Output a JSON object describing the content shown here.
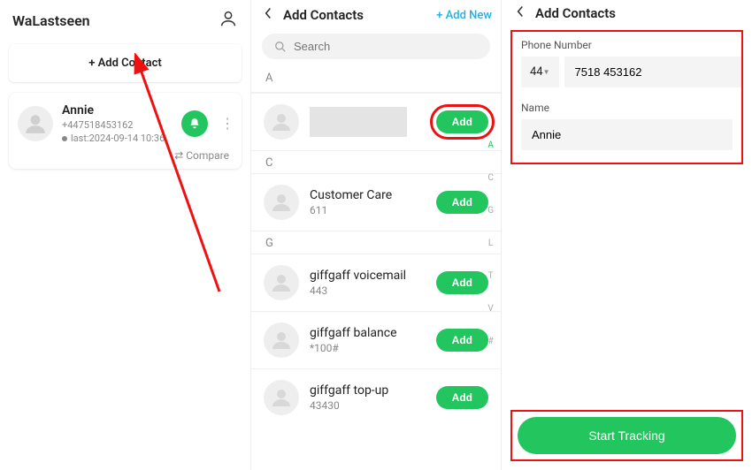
{
  "app": {
    "title": "WaLastseen",
    "add_contact_label": "+ Add Contact"
  },
  "tracked_contact": {
    "name": "Annie",
    "phone": "+447518453162",
    "last_seen": "last:2024-09-14 10:36",
    "compare_label": "Compare"
  },
  "add_contacts": {
    "title": "Add Contacts",
    "add_new_label": "+ Add New",
    "search_placeholder": "Search",
    "add_button_label": "Add",
    "sections": {
      "A": "A",
      "C": "C",
      "G": "G"
    },
    "items": [
      {
        "name": "",
        "sub": "",
        "masked": true
      },
      {
        "name": "Customer Care",
        "sub": "611"
      },
      {
        "name": "giffgaff voicemail",
        "sub": "443"
      },
      {
        "name": "giffgaff balance",
        "sub": "*100#"
      },
      {
        "name": "giffgaff top-up",
        "sub": "43430"
      }
    ],
    "index_letters": [
      "A",
      "C",
      "G",
      "L",
      "T",
      "V",
      "#"
    ]
  },
  "form": {
    "title": "Add Contacts",
    "phone_label": "Phone Number",
    "country_code": "44",
    "phone_value": "7518 453162",
    "name_label": "Name",
    "name_value": "Annie",
    "start_label": "Start Tracking"
  }
}
